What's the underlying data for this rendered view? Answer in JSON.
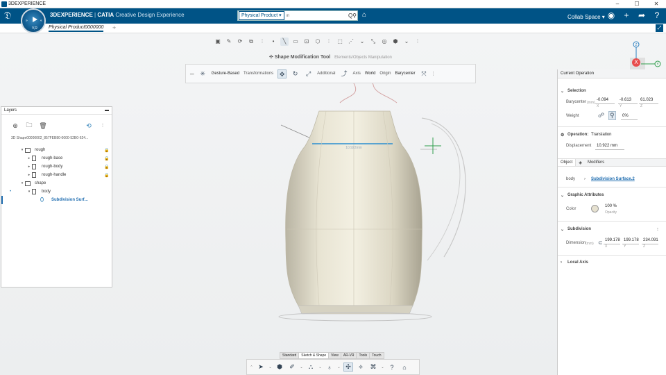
{
  "window": {
    "title": "3DEXPERIENCE",
    "controls": [
      "–",
      "☐",
      "✕"
    ]
  },
  "header": {
    "brand_bold": "3DEXPERIENCE",
    "brand_sep": " | ",
    "brand_app": "CATIA",
    "brand_role": " Creative Design Experience",
    "search_scope": "Physical Product ▾",
    "search_placeholder": "in",
    "search_glyph": "Q⚲",
    "collab_space": "Collab Space ▾",
    "compass_vr": "V,R"
  },
  "tabs": {
    "document": "Physical Product0000000",
    "add": "+"
  },
  "shape_tool": {
    "title": "Shape Modification Tool",
    "subtitle": "Elements/Objects Manipulation",
    "mode": "Gesture-Based",
    "transformations_label": "Transformations",
    "additional_label": "Additional",
    "axis_label": "Axis",
    "axis_value": "World",
    "origin_label": "Origin",
    "origin_value": "Barycenter"
  },
  "layers": {
    "title": "Layers",
    "root": "3D Shape00000002_857FEB80-0000-52B0-624...",
    "items": [
      {
        "label": "rough",
        "level": 1,
        "type": "folder",
        "arrow": "▾"
      },
      {
        "label": "rough-base",
        "level": 2,
        "type": "doc",
        "arrow": "▸"
      },
      {
        "label": "rough-body",
        "level": 2,
        "type": "doc",
        "arrow": "▸"
      },
      {
        "label": "rough-handle",
        "level": 2,
        "type": "doc",
        "arrow": "▸"
      },
      {
        "label": "shape",
        "level": 1,
        "type": "folder",
        "arrow": "▾"
      },
      {
        "label": "body",
        "level": 2,
        "type": "doc",
        "arrow": "▾"
      },
      {
        "label": "Subdivision Surf...",
        "level": 3,
        "type": "surface",
        "arrow": ""
      }
    ]
  },
  "current_operation": {
    "title": "Current Operation",
    "selection_label": "Selection",
    "barycenter_label": "Barycenter",
    "barycenter_unit": "(mm)",
    "barycenter": {
      "x": "-0.094",
      "y": "-0.613",
      "z": "61.023"
    },
    "weight_label": "Weight",
    "weight_value": "0%",
    "operation_label": "Operation:",
    "operation_value": "Translation",
    "displacement_label": "Displacement",
    "displacement_value": "10.922 mm"
  },
  "object": {
    "tab_object": "Object",
    "tab_modifiers": "Modifiers",
    "name": "body",
    "link": "Subdivision Surface.2",
    "graphic_label": "Graphic Attributes",
    "color_label": "Color",
    "opacity_value": "100 %",
    "opacity_label": "Opacity",
    "subdivision_label": "Subdivision",
    "dimension_label": "Dimension",
    "dimension_unit": "(mm)",
    "dimension": {
      "x": "199.178",
      "y": "199.178",
      "z": "234.091"
    },
    "local_axis_label": "Local Axis"
  },
  "axes": {
    "x": "X",
    "y": "Y",
    "z": "Z"
  },
  "viewport": {
    "measure": "10.922mm"
  },
  "bottom_tabs": [
    "Standard",
    "Sketch & Shape",
    "View",
    "AR-VR",
    "Tools",
    "Touch"
  ],
  "colors": {
    "accent": "#005386",
    "link": "#1f6db0",
    "model": "#e3dfcd"
  }
}
